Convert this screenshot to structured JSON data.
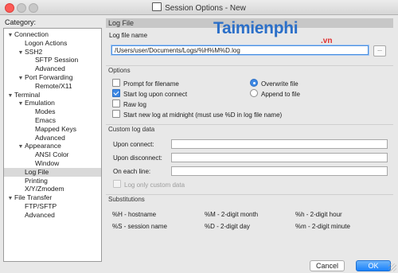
{
  "window": {
    "title": "Session Options - New"
  },
  "category_label": "Category:",
  "tree": [
    {
      "label": "Connection",
      "level": 0,
      "expanded": true
    },
    {
      "label": "Logon Actions",
      "level": 1
    },
    {
      "label": "SSH2",
      "level": 1,
      "expanded": true
    },
    {
      "label": "SFTP Session",
      "level": 2
    },
    {
      "label": "Advanced",
      "level": 2
    },
    {
      "label": "Port Forwarding",
      "level": 1,
      "expanded": true
    },
    {
      "label": "Remote/X11",
      "level": 2
    },
    {
      "label": "Terminal",
      "level": 0,
      "expanded": true
    },
    {
      "label": "Emulation",
      "level": 1,
      "expanded": true
    },
    {
      "label": "Modes",
      "level": 2
    },
    {
      "label": "Emacs",
      "level": 2
    },
    {
      "label": "Mapped Keys",
      "level": 2
    },
    {
      "label": "Advanced",
      "level": 2
    },
    {
      "label": "Appearance",
      "level": 1,
      "expanded": true
    },
    {
      "label": "ANSI Color",
      "level": 2
    },
    {
      "label": "Window",
      "level": 2
    },
    {
      "label": "Log File",
      "level": 1,
      "selected": true
    },
    {
      "label": "Printing",
      "level": 1
    },
    {
      "label": "X/Y/Zmodem",
      "level": 1
    },
    {
      "label": "File Transfer",
      "level": 0,
      "expanded": true
    },
    {
      "label": "FTP/SFTP",
      "level": 1
    },
    {
      "label": "Advanced",
      "level": 1
    }
  ],
  "panel": {
    "title": "Log File",
    "log_file_name_label": "Log file name",
    "log_file_name_value": "/Users/user/Documents/Logs/%H%M%D.log",
    "browse_label": "...",
    "options_header": "Options",
    "prompt_label": "Prompt for filename",
    "start_log_label": "Start log upon connect",
    "raw_log_label": "Raw log",
    "midnight_label": "Start new log at midnight (must use %D in log file name)",
    "overwrite_label": "Overwrite file",
    "append_label": "Append to file",
    "custom_header": "Custom log data",
    "upon_connect_label": "Upon connect:",
    "upon_disconnect_label": "Upon disconnect:",
    "each_line_label": "On each line:",
    "upon_connect_value": "",
    "upon_disconnect_value": "",
    "each_line_value": "",
    "log_only_custom_label": "Log only custom data",
    "subst_header": "Substitutions",
    "substitutions": [
      "%H - hostname",
      "%M - 2-digit month",
      "%h - 2-digit hour",
      "%S - session name",
      "%D - 2-digit day",
      "%m - 2-digit minute"
    ]
  },
  "buttons": {
    "cancel": "Cancel",
    "ok": "OK"
  },
  "watermark": {
    "main": "Taimienphi",
    "sub": ".vn"
  },
  "colors": {
    "accent": "#3d88e4",
    "ok_button": "#1a82fb",
    "close_button": "#fc5b57"
  }
}
